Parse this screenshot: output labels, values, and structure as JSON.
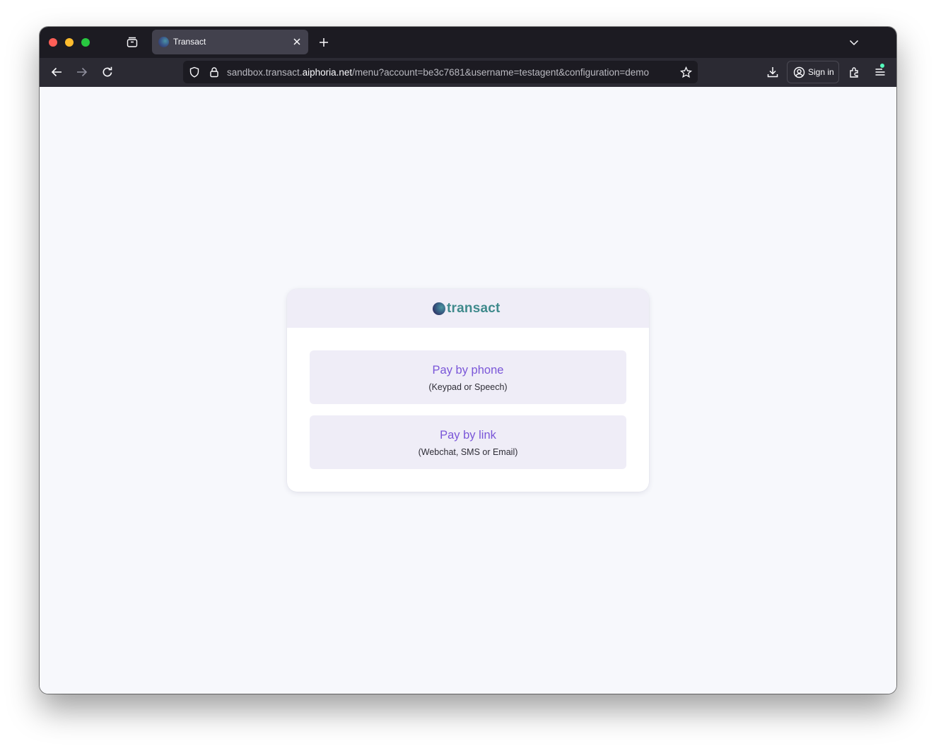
{
  "browser": {
    "tab": {
      "title": "Transact"
    },
    "url": {
      "prefix": "sandbox.transact.",
      "domain": "aiphoria.net",
      "path": "/menu?account=be3c7681&username=testagent&configuration=demo"
    },
    "sign_in_label": "Sign in",
    "icons": {
      "tab_overview": "tab-overview-icon",
      "new_tab": "plus-icon",
      "tab_list": "chevron-down-icon",
      "back": "arrow-left-icon",
      "forward": "arrow-right-icon",
      "reload": "reload-icon",
      "shield": "shield-icon",
      "lock": "lock-icon",
      "bookmark": "star-icon",
      "downloads": "download-icon",
      "extensions": "puzzle-icon",
      "menu": "hamburger-menu-icon"
    }
  },
  "page": {
    "logo_text": "transact",
    "options": [
      {
        "title": "Pay by phone",
        "subtitle": "(Keypad or Speech)"
      },
      {
        "title": "Pay by link",
        "subtitle": "(Webchat, SMS or Email)"
      }
    ]
  },
  "colors": {
    "accent": "#7a56d8",
    "logo": "#3f8a8c",
    "option_bg": "#efedf7",
    "page_bg": "#f7f8fc"
  }
}
